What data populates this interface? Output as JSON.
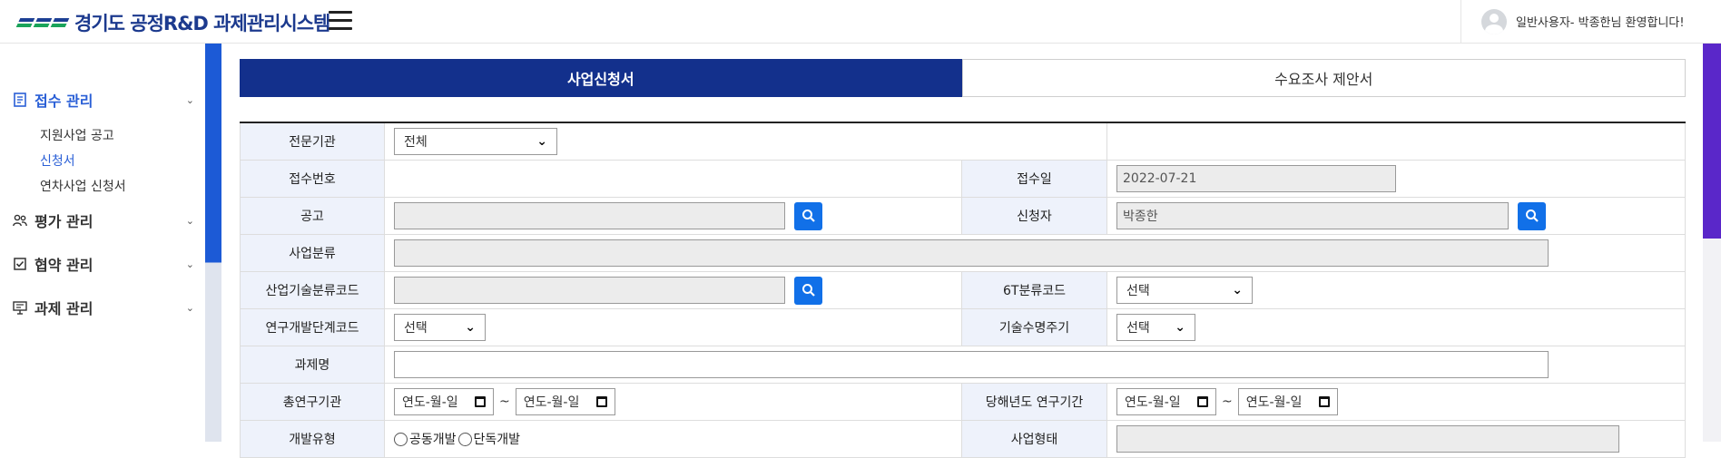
{
  "header": {
    "logo_text": "경기도 공정R&D 과제관리시스템",
    "user_greeting": "일반사용자- 박종한님 환영합니다!"
  },
  "sidebar": {
    "groups": [
      {
        "label": "접수 관리",
        "icon": "document-icon",
        "active": true,
        "items": [
          "지원사업 공고",
          "신청서",
          "연차사업 신청서"
        ]
      },
      {
        "label": "평가 관리",
        "icon": "users-icon"
      },
      {
        "label": "협약 관리",
        "icon": "checkbox-icon"
      },
      {
        "label": "과제 관리",
        "icon": "presentation-icon"
      }
    ]
  },
  "tabs": [
    "사업신청서",
    "수요조사 제안서"
  ],
  "form": {
    "labels": {
      "agency": "전문기관",
      "receipt_no": "접수번호",
      "receipt_date": "접수일",
      "notice": "공고",
      "applicant": "신청자",
      "biz_class": "사업분류",
      "industry_code": "산업기술분류코드",
      "sixt_code": "6T분류코드",
      "stage_code": "연구개발단계코드",
      "lifecycle": "기술수명주기",
      "project_name": "과제명",
      "total_period": "총연구기관",
      "year_period": "당해년도 연구기간",
      "dev_type": "개발유형",
      "biz_type": "사업형태"
    },
    "values": {
      "agency_select": "전체",
      "receipt_date": "2022-07-21",
      "applicant": "박종한",
      "sixt_select": "선택",
      "stage_select": "선택",
      "lifecycle_select": "선택",
      "date_placeholder": "연도-월-일",
      "tilde": "~",
      "radio_joint": "공동개발",
      "radio_single": "단독개발"
    }
  },
  "colors": {
    "brand": "#13308c",
    "accent_blue": "#1170e8",
    "label_bg": "#eef2fb"
  }
}
